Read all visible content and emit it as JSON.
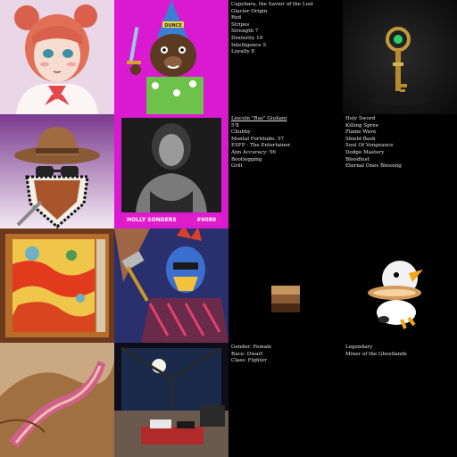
{
  "capybara": {
    "lines": [
      "Capybara, the Savior of the Lost",
      "Glacier Origin",
      "Red",
      "Stripes",
      "Strength 7",
      "Dexterity 10",
      "Intelligence 5",
      "Loyalty 8"
    ]
  },
  "gnome": {
    "hat_text": "DUNCE"
  },
  "holly": {
    "name": "HOLLY SONDERS",
    "number": "#0080"
  },
  "lincoln": {
    "lines": [
      "Lincoln \"Ras\" Giuliani",
      "5'8",
      "Chubby",
      "Mental Fortitude: 57",
      "ESFP - The Entertainer",
      "Aim Accuracy: 56",
      "Bootlegging",
      "Grill"
    ]
  },
  "sword": {
    "lines": [
      "Holy Sword",
      "Killing Spree",
      "Flame Wave",
      "Shield Bash",
      "Soul Of Vengeance",
      "Dodge Mastery",
      "Bloodlust",
      "Eternal Ones Blessing"
    ]
  },
  "dwarf": {
    "lines": [
      "Gender: Female",
      "Race: Dwarf",
      "Class: Fighter"
    ]
  },
  "miner": {
    "lines": [
      "Legendary",
      "Miner of the Ghostlands"
    ]
  },
  "colors": {
    "magenta": "#d91ad0",
    "holly_bar": "#e01ec8",
    "text": "#e8e8e8",
    "bg": "#000000"
  }
}
